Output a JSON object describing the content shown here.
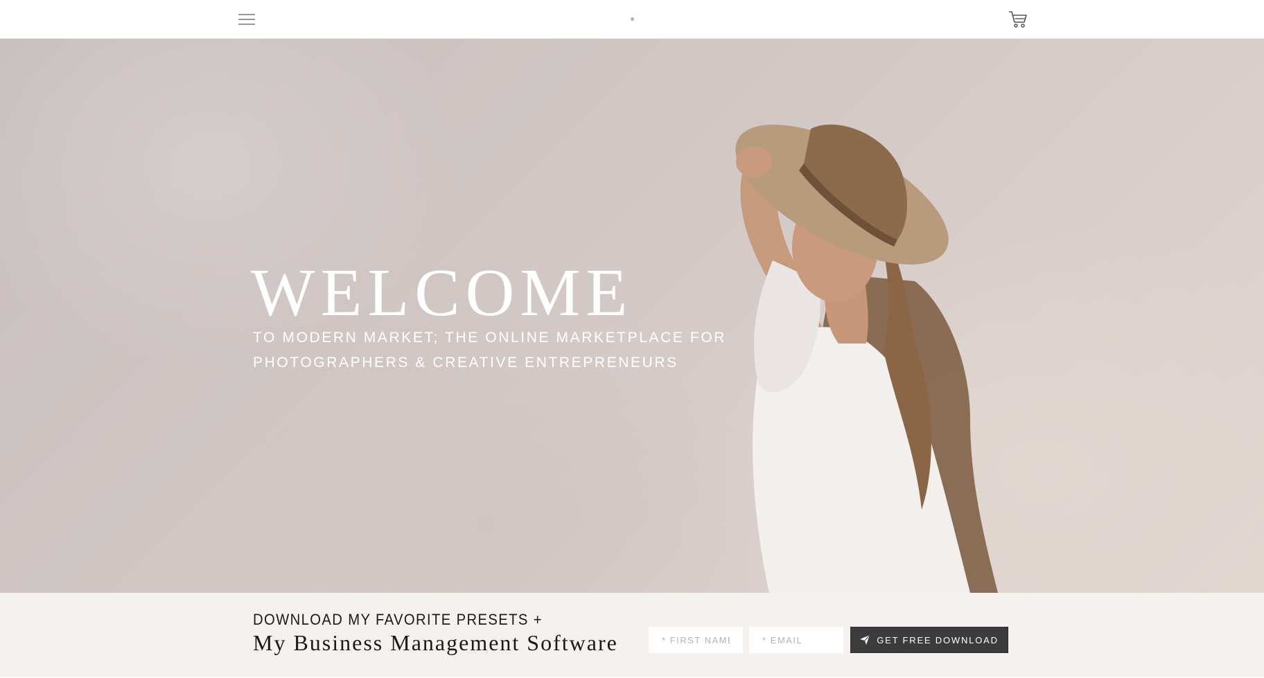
{
  "header": {
    "menu_icon": "hamburger-menu-icon",
    "cart_icon": "shopping-cart-icon",
    "logo_accent_color": "#9fb4e6"
  },
  "hero": {
    "title": "WELCOME",
    "subtitle": "TO MODERN MARKET; THE ONLINE MARKETPLACE FOR PHOTOGRAPHERS & CREATIVE ENTREPRENEURS"
  },
  "optin": {
    "kicker": "DOWNLOAD MY FAVORITE PRESETS +",
    "title": "My Business Management Software",
    "first_name_placeholder": "* FIRST NAME",
    "email_placeholder": "* EMAIL",
    "button_label": "GET FREE DOWNLOAD",
    "button_icon": "paper-plane-icon",
    "button_color": "#3b3b3d"
  }
}
